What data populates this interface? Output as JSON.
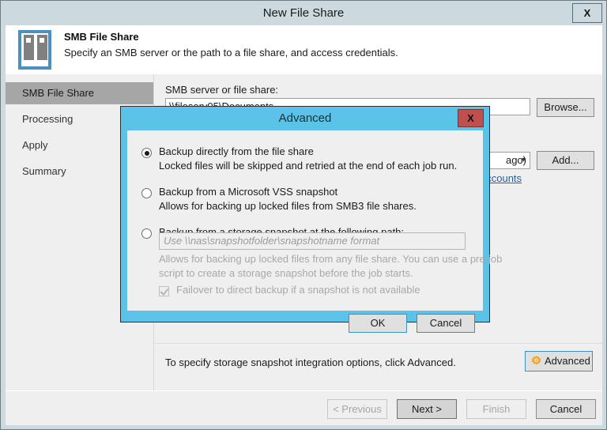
{
  "window": {
    "title": "New File Share",
    "close_label": "X"
  },
  "header": {
    "title": "SMB File Share",
    "subtitle": "Specify an SMB server or the path to a file share, and access credentials.",
    "icon": "file-share-icon"
  },
  "sidebar": {
    "items": [
      {
        "label": "SMB File Share",
        "selected": true
      },
      {
        "label": "Processing",
        "selected": false
      },
      {
        "label": "Apply",
        "selected": false
      },
      {
        "label": "Summary",
        "selected": false
      }
    ]
  },
  "pane": {
    "server_label": "SMB server or file share:",
    "server_value": "\\\\fileserv05\\Documents",
    "browse_label": "Browse...",
    "credentials_value": "ago)",
    "add_label": "Add...",
    "manage_accounts_link": "accounts",
    "dropdown_icon": "chevron-down-icon"
  },
  "advanced_strip": {
    "hint": "To specify storage snapshot integration options, click Advanced.",
    "button_label": "Advanced",
    "gear_icon": "gear-icon",
    "gear_color": "#F5A623"
  },
  "footer": {
    "previous_label": "< Previous",
    "next_label": "Next >",
    "finish_label": "Finish",
    "cancel_label": "Cancel"
  },
  "dialog": {
    "title": "Advanced",
    "close_label": "X",
    "border_color": "#5BC3E8",
    "close_color": "#C0504D",
    "options": [
      {
        "label": "Backup directly from the file share",
        "desc": "Locked files will be skipped and retried at the end of each job run.",
        "selected": true
      },
      {
        "label": "Backup from a Microsoft VSS snapshot",
        "desc": "Allows for backing up locked files from SMB3 file shares.",
        "selected": false
      },
      {
        "label": "Backup from a storage snapshot at the following path:",
        "selected": false
      }
    ],
    "path_placeholder": "Use \\\\nas\\snapshotfolder\\snapshotname format",
    "path_desc_line1": "Allows for backing up locked files from any file share. You can use a pre-job",
    "path_desc_line2": "script to create a storage snapshot before the job starts.",
    "failover_label": "Failover to direct backup if a snapshot is not available",
    "failover_checked": true,
    "ok_label": "OK",
    "cancel_label": "Cancel"
  }
}
